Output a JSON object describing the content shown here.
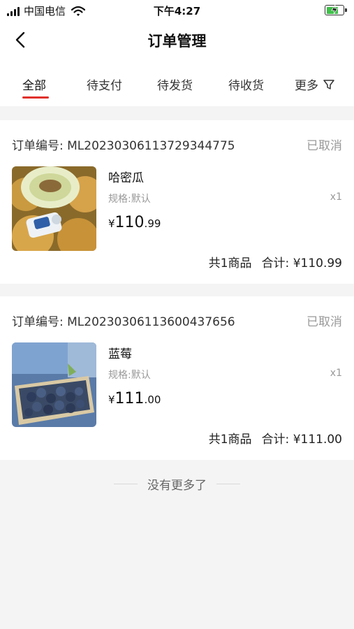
{
  "status_bar": {
    "carrier": "中国电信",
    "time": "下午4:27",
    "battery_level": 0.7,
    "battery_charging": true
  },
  "nav": {
    "title": "订单管理"
  },
  "tabs": [
    {
      "label": "全部",
      "active": true
    },
    {
      "label": "待支付",
      "active": false
    },
    {
      "label": "待发货",
      "active": false
    },
    {
      "label": "待收货",
      "active": false
    },
    {
      "label": "更多",
      "active": false
    }
  ],
  "orders": [
    {
      "order_no_label": "订单编号:",
      "order_no": "ML20230306113729344775",
      "status": "已取消",
      "product": {
        "name": "哈密瓜",
        "spec": "规格:默认",
        "qty": "x1",
        "currency": "¥",
        "price_int": "110",
        "price_dec": ".99",
        "image": "melon-photo"
      },
      "count_text": "共1商品",
      "total_text": "合计: ¥110.99"
    },
    {
      "order_no_label": "订单编号:",
      "order_no": "ML20230306113600437656",
      "status": "已取消",
      "product": {
        "name": "蓝莓",
        "spec": "规格:默认",
        "qty": "x1",
        "currency": "¥",
        "price_int": "111",
        "price_dec": ".00",
        "image": "blueberry-photo"
      },
      "count_text": "共1商品",
      "total_text": "合计: ¥111.00"
    }
  ],
  "footer": {
    "end_text": "没有更多了"
  },
  "colors": {
    "accent": "#e0302a",
    "muted": "#999999",
    "page_bg": "#f4f4f4"
  },
  "icons": [
    "signal-icon",
    "wifi-icon",
    "battery-icon",
    "back-arrow-icon",
    "filter-icon"
  ]
}
